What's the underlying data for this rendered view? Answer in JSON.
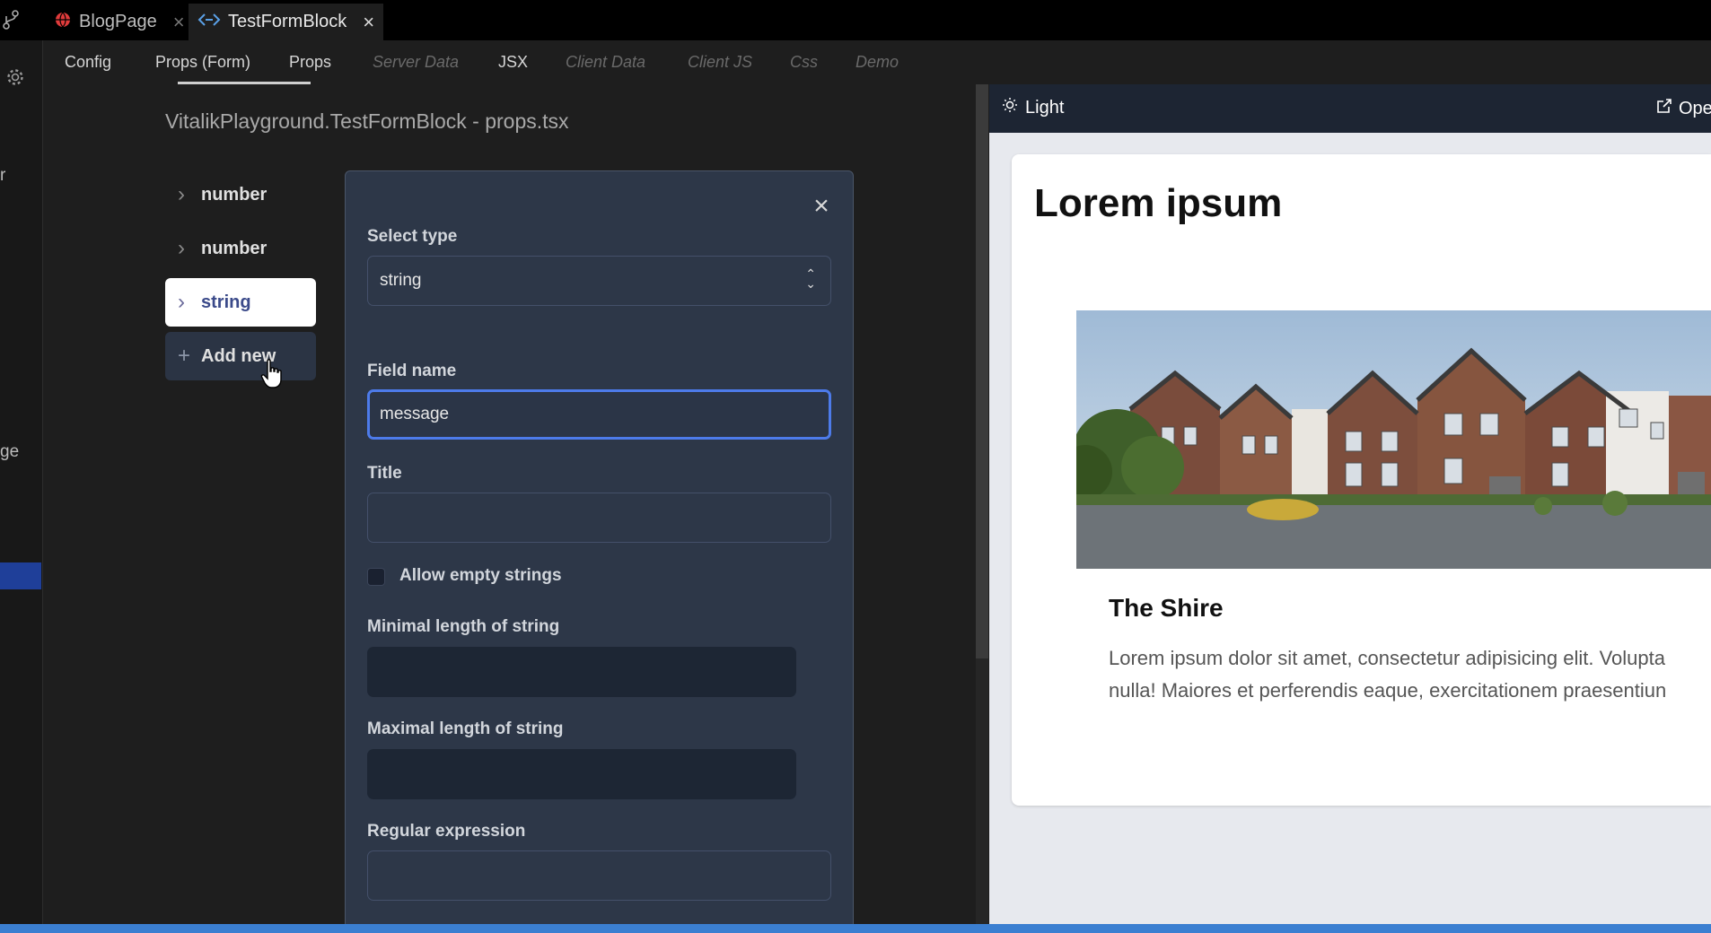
{
  "titlebar": {
    "tabs": [
      {
        "label": "BlogPage",
        "icon": "globe-icon",
        "active": false
      },
      {
        "label": "TestFormBlock",
        "icon": "code-icon",
        "active": true
      }
    ]
  },
  "activity": {
    "partial_labels": [
      "r",
      "ge"
    ]
  },
  "subtabs": [
    {
      "label": "Config",
      "enabled": true
    },
    {
      "label": "Props (Form)",
      "enabled": true,
      "active": true
    },
    {
      "label": "Props",
      "enabled": true
    },
    {
      "label": "Server Data",
      "enabled": false
    },
    {
      "label": "JSX",
      "enabled": true
    },
    {
      "label": "Client Data",
      "enabled": false
    },
    {
      "label": "Client JS",
      "enabled": false
    },
    {
      "label": "Css",
      "enabled": false
    },
    {
      "label": "Demo",
      "enabled": false
    }
  ],
  "filepath": "VitalikPlayground.TestFormBlock - props.tsx",
  "fields": [
    {
      "label": "number",
      "selected": false
    },
    {
      "label": "number",
      "selected": false
    },
    {
      "label": "string",
      "selected": true
    }
  ],
  "add_new_label": "Add new",
  "form": {
    "select_type_label": "Select type",
    "select_type_value": "string",
    "field_name_label": "Field name",
    "field_name_value": "message",
    "title_label": "Title",
    "title_value": "",
    "allow_empty_label": "Allow empty strings",
    "allow_empty_checked": false,
    "min_length_label": "Minimal length of string",
    "min_length_value": "",
    "max_length_label": "Maximal length of string",
    "max_length_value": "",
    "regex_label": "Regular expression",
    "regex_value": ""
  },
  "preview": {
    "theme_label": "Light",
    "open_label": "Ope",
    "heading": "Lorem ipsum",
    "card_title": "The Shire",
    "card_body_line1": "Lorem ipsum dolor sit amet, consectetur adipisicing elit. Volupta",
    "card_body_line2": "nulla! Maiores et perferendis eaque, exercitationem praesentiun"
  },
  "colors": {
    "accent_blue": "#4d7bea",
    "selection_blue": "#1f3f99",
    "panel_bg": "#2d3748",
    "status_bar": "#3b7fd1"
  }
}
